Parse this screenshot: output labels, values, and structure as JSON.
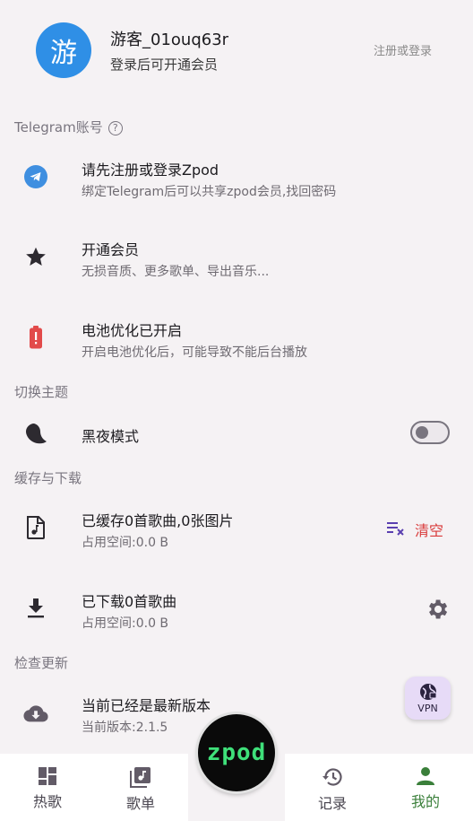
{
  "profile": {
    "avatar_char": "游",
    "username": "游客_01ouq63r",
    "subtitle": "登录后可开通会员",
    "login_label": "注册或登录"
  },
  "sections": {
    "telegram": "Telegram账号",
    "theme": "切换主题",
    "cache": "缓存与下载",
    "update": "检查更新"
  },
  "rows": {
    "telegram": {
      "title": "请先注册或登录Zpod",
      "sub": "绑定Telegram后可以共享zpod会员,找回密码"
    },
    "vip": {
      "title": "开通会员",
      "sub": "无损音质、更多歌单、导出音乐..."
    },
    "battery": {
      "title": "电池优化已开启",
      "sub": "开启电池优化后，可能导致不能后台播放"
    },
    "dark": {
      "title": "黑夜模式",
      "enabled": false
    },
    "cache": {
      "title": "已缓存0首歌曲,0张图片",
      "sub": "占用空间:0.0 B",
      "clear_label": "清空"
    },
    "download": {
      "title": "已下载0首歌曲",
      "sub": "占用空间:0.0 B"
    },
    "version": {
      "title": "当前已经是最新版本",
      "sub": "当前版本:2.1.5"
    }
  },
  "fab": {
    "label": "VPN"
  },
  "center_button": {
    "label": "zpod"
  },
  "nav": [
    {
      "label": "热歌",
      "icon": "dashboard-icon",
      "active": false
    },
    {
      "label": "歌单",
      "icon": "playlist-icon",
      "active": false
    },
    {
      "label": "记录",
      "icon": "history-icon",
      "active": false
    },
    {
      "label": "我的",
      "icon": "person-icon",
      "active": true
    }
  ],
  "colors": {
    "accent_green": "#3a7f3a",
    "danger": "#d93a3a",
    "avatar": "#2f8fe6",
    "zpod_text": "#3fe07a"
  }
}
